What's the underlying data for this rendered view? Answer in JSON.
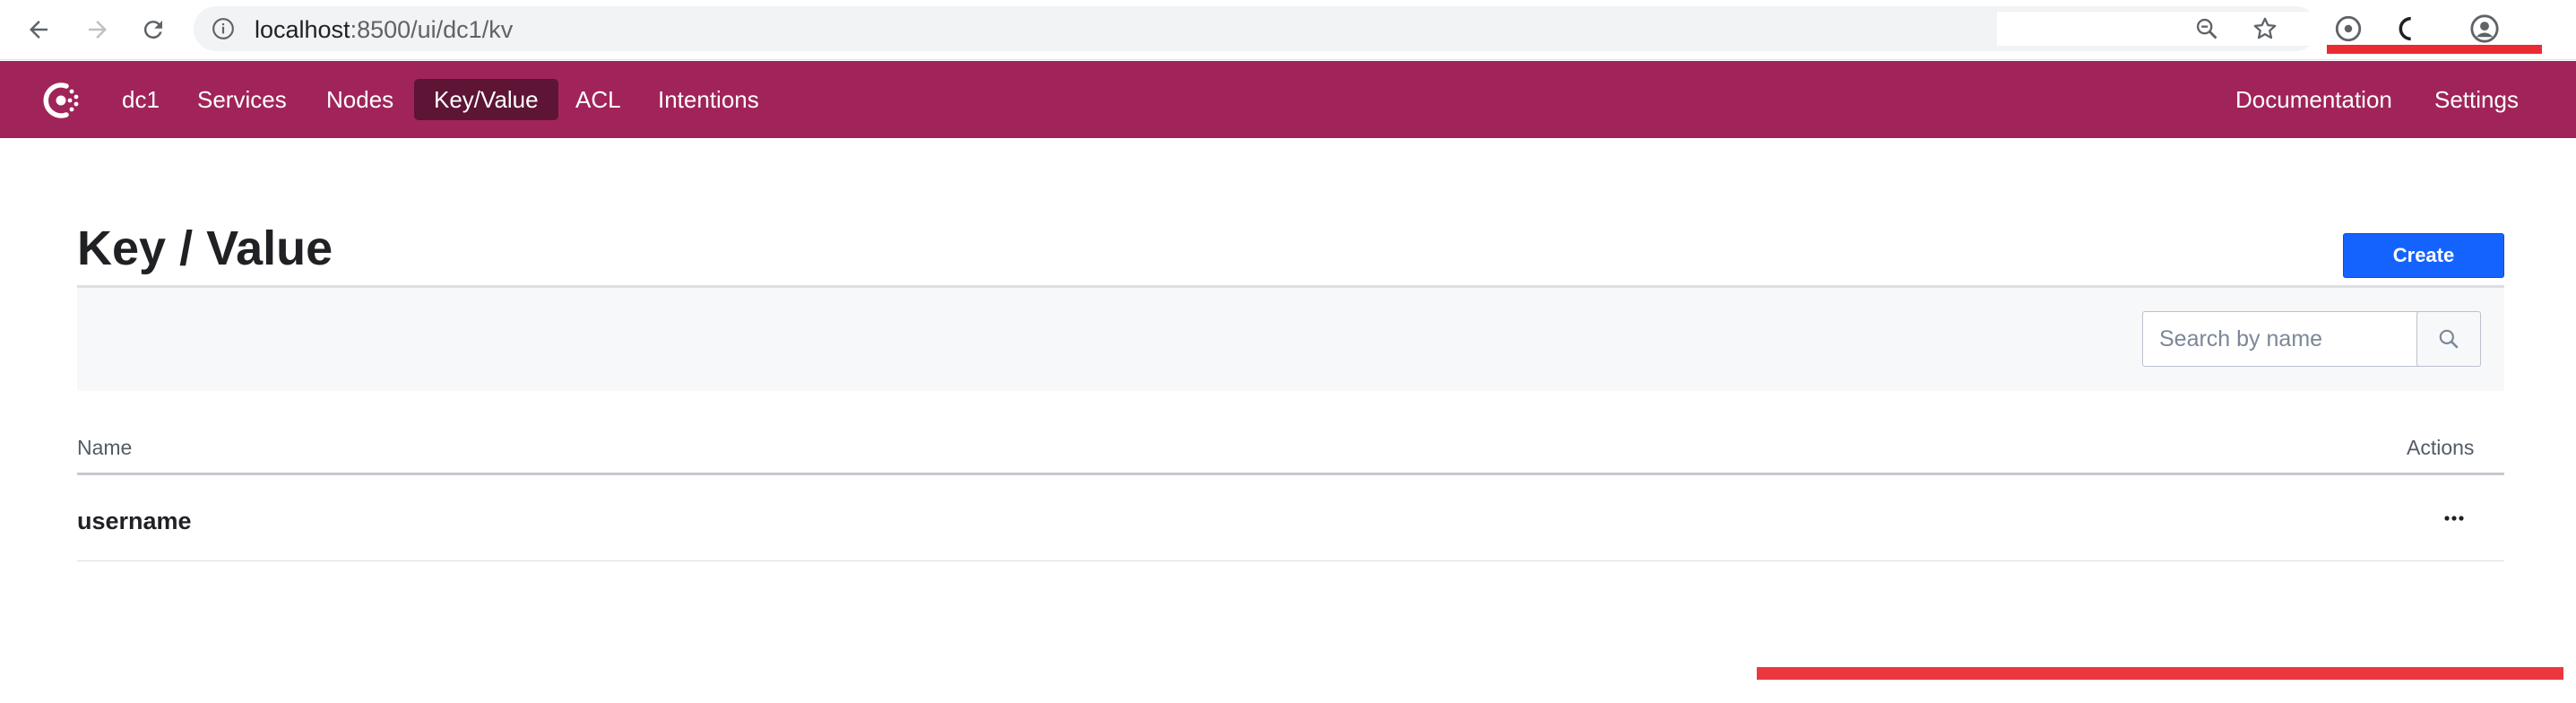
{
  "browser": {
    "url_host": "localhost",
    "url_rest": ":8500/ui/dc1/kv"
  },
  "nav": {
    "datacenter": "dc1",
    "items": [
      "Services",
      "Nodes",
      "Key/Value",
      "ACL",
      "Intentions"
    ],
    "active": "Key/Value",
    "right_items": [
      "Documentation",
      "Settings"
    ]
  },
  "page": {
    "title": "Key / Value",
    "create_label": "Create",
    "search_placeholder": "Search by name"
  },
  "table": {
    "columns": [
      "Name",
      "Actions"
    ],
    "rows": [
      {
        "name": "username",
        "actions": "···"
      }
    ]
  },
  "colors": {
    "brand": "#a02459",
    "brand_active": "#5d1435",
    "primary_button": "#1563ff",
    "watermark": "#e8141b"
  },
  "icons": [
    "back-arrow-icon",
    "forward-arrow-icon",
    "reload-icon",
    "info-icon",
    "zoom-icon",
    "star-icon",
    "consul-logo",
    "search-icon",
    "more-actions-icon"
  ]
}
